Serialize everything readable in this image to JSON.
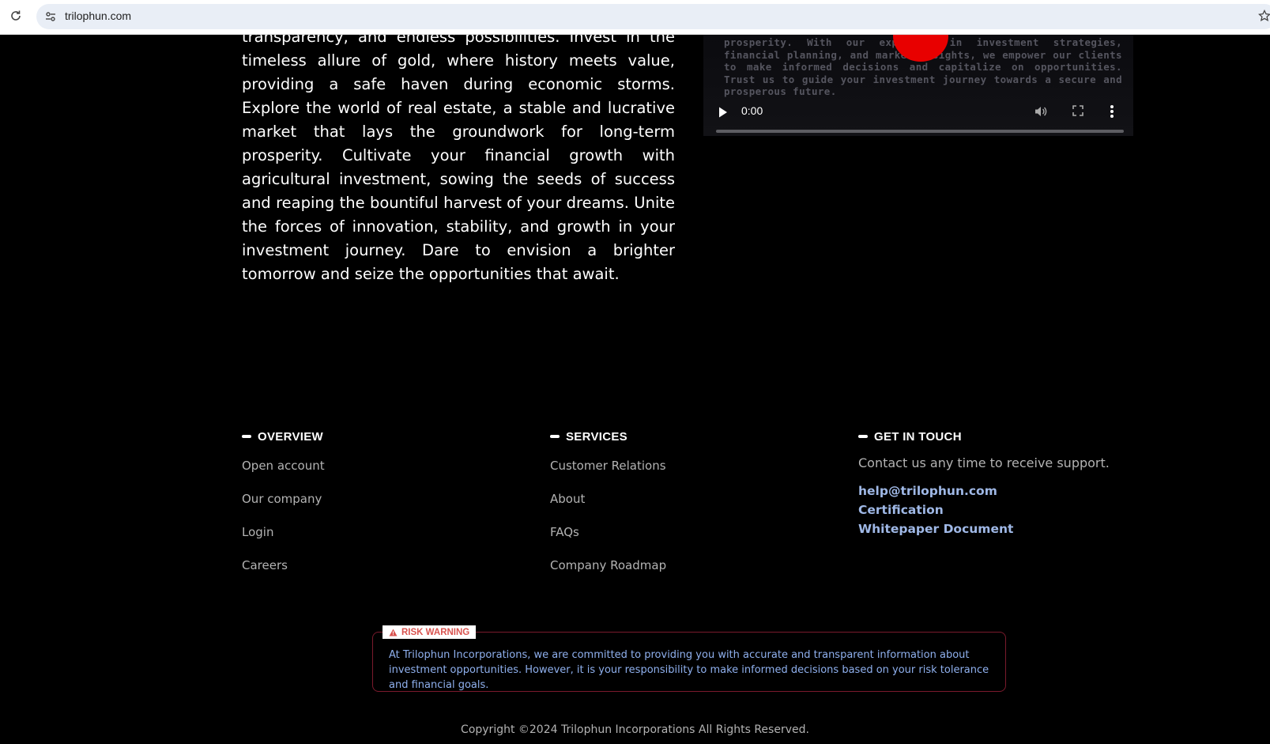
{
  "browser": {
    "url": "trilophun.com"
  },
  "intro": {
    "paragraph": "transparency, and endless possibilities. Invest in the timeless allure of gold, where history meets value, providing a safe haven during economic storms. Explore the world of real estate, a stable and lucrative market that lays the groundwork for long-term prosperity. Cultivate your financial growth with agricultural investment, sowing the seeds of success and reaping the bountiful harvest of your dreams. Unite the forces of innovation, stability, and growth in your investment journey. Dare to envision a brighter tomorrow and seize the opportunities that await."
  },
  "video": {
    "overlay_text": "prosperity. With our expertise in investment strategies, financial planning, and market insights, we empower our clients to make informed decisions and capitalize on opportunities. Trust us to guide your investment journey towards a secure and prosperous future.",
    "time": "0:00"
  },
  "footer": {
    "overview": {
      "heading": "OVERVIEW",
      "links": [
        "Open account",
        "Our company",
        "Login",
        "Careers"
      ]
    },
    "services": {
      "heading": "SERVICES",
      "links": [
        "Customer Relations",
        "About",
        "FAQs",
        "Company Roadmap"
      ]
    },
    "contact": {
      "heading": "GET IN TOUCH",
      "text": "Contact us any time to receive support.",
      "email": "help@trilophun.com",
      "certification": "Certification",
      "whitepaper": "Whitepaper Document"
    }
  },
  "risk": {
    "label": "RISK WARNING",
    "text": "At Trilophun Incorporations, we are committed to providing you with accurate and transparent information about investment opportunities. However, it is your responsibility to make informed decisions based on your risk tolerance and financial goals."
  },
  "copyright": "Copyright ©2024 Trilophun Incorporations All Rights Reserved."
}
